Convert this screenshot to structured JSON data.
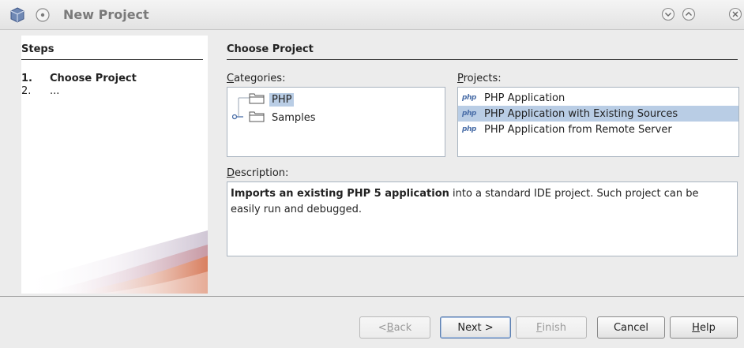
{
  "window": {
    "title": "New Project",
    "icons": [
      "netbeans-cube-icon",
      "radio-icon",
      "minimize-icon",
      "maximize-icon",
      "close-icon"
    ]
  },
  "steps": {
    "heading": "Steps",
    "items": [
      {
        "num": "1.",
        "label": "Choose Project"
      },
      {
        "num": "2.",
        "label": "..."
      }
    ]
  },
  "panel": {
    "heading": "Choose Project",
    "categories_label_first": "C",
    "categories_label_rest": "ategories:",
    "projects_label_first": "P",
    "projects_label_rest": "rojects:",
    "description_label_first": "D",
    "description_label_rest": "escription:",
    "categories": [
      {
        "label": "PHP",
        "selected": true
      },
      {
        "label": "Samples",
        "selected": false
      }
    ],
    "projects": [
      {
        "label": "PHP Application",
        "selected": false
      },
      {
        "label": "PHP Application with Existing Sources",
        "selected": true
      },
      {
        "label": "PHP Application from Remote Server",
        "selected": false
      }
    ],
    "php_icon_text": "php",
    "description_bold": "Imports an existing PHP 5 application",
    "description_rest": " into a standard IDE project. Such project can be easily run and debugged."
  },
  "buttons": {
    "back_prefix": "< ",
    "back_mnemonic": "B",
    "back_rest": "ack",
    "next": "Next >",
    "finish_mnemonic": "F",
    "finish_rest": "inish",
    "cancel": "Cancel",
    "help_mnemonic": "H",
    "help_rest": "elp"
  },
  "colors": {
    "selection": "#b9cde5",
    "accent": "#4a6ea8"
  }
}
